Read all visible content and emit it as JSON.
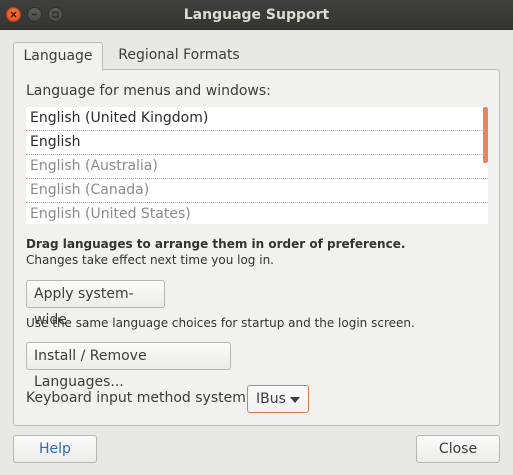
{
  "window": {
    "title": "Language Support",
    "controls": [
      "close-icon",
      "minimize-icon",
      "maximize-icon"
    ]
  },
  "tabs": [
    {
      "label": "Language",
      "active": true
    },
    {
      "label": "Regional Formats",
      "active": false
    }
  ],
  "language_tab": {
    "heading": "Language for menus and windows:",
    "languages": [
      {
        "label": "English (United Kingdom)",
        "enabled": true
      },
      {
        "label": "English",
        "enabled": true
      },
      {
        "label": "English (Australia)",
        "enabled": false
      },
      {
        "label": "English (Canada)",
        "enabled": false
      },
      {
        "label": "English (United States)",
        "enabled": false
      }
    ],
    "drag_hint": "Drag languages to arrange them in order of preference.",
    "effect_note": "Changes take effect next time you log in.",
    "apply_button": "Apply system-wide",
    "apply_note": "Use the same language choices for startup and the login screen.",
    "install_button": "Install / Remove Languages...",
    "keyboard_label": "Keyboard input method system:",
    "keyboard_value": "IBus"
  },
  "footer": {
    "help_button": "Help",
    "close_button": "Close"
  },
  "colors": {
    "accent": "#e07a50",
    "titlebar": "#3c3b37",
    "help_text": "#2c6db0"
  }
}
